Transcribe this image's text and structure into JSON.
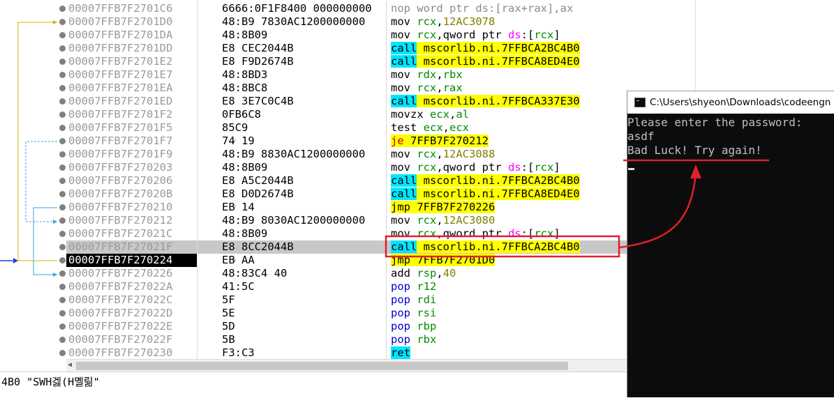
{
  "disassembly": {
    "rows": [
      {
        "address": "00007FFB7F2701C6",
        "bytes": "6666:0F1F8400 000000000",
        "mnemonic": "nop",
        "mclass": "nop",
        "operands": [
          {
            "t": "word ptr ds:[rax+rax],ax",
            "c": "nop"
          }
        ]
      },
      {
        "address": "00007FFB7F2701D0",
        "bytes": "48:B9 7830AC1200000000",
        "mnemonic": "mov",
        "mclass": "mov",
        "operands": [
          {
            "t": " ",
            "c": "plain"
          },
          {
            "t": "rcx",
            "c": "reg"
          },
          {
            "t": ",",
            "c": "plain"
          },
          {
            "t": "12AC3078",
            "c": "num"
          }
        ]
      },
      {
        "address": "00007FFB7F2701DA",
        "bytes": "48:8B09",
        "mnemonic": "mov",
        "mclass": "mov",
        "operands": [
          {
            "t": " ",
            "c": "plain"
          },
          {
            "t": "rcx",
            "c": "reg"
          },
          {
            "t": ",qword ptr ",
            "c": "plain"
          },
          {
            "t": "ds",
            "c": "seg"
          },
          {
            "t": ":[",
            "c": "plain"
          },
          {
            "t": "rcx",
            "c": "reg"
          },
          {
            "t": "]",
            "c": "plain"
          }
        ]
      },
      {
        "address": "00007FFB7F2701DD",
        "bytes": "E8 CEC2044B",
        "mnemonic": "call",
        "mclass": "call",
        "operands": [
          {
            "t": " mscorlib.ni.7FFBCA2BC4B0",
            "c": "tgtbg"
          }
        ]
      },
      {
        "address": "00007FFB7F2701E2",
        "bytes": "E8 F9D2674B",
        "mnemonic": "call",
        "mclass": "call",
        "operands": [
          {
            "t": " mscorlib.ni.7FFBCA8ED4E0",
            "c": "tgtbg"
          }
        ]
      },
      {
        "address": "00007FFB7F2701E7",
        "bytes": "48:8BD3",
        "mnemonic": "mov",
        "mclass": "mov",
        "operands": [
          {
            "t": " ",
            "c": "plain"
          },
          {
            "t": "rdx",
            "c": "reg"
          },
          {
            "t": ",",
            "c": "plain"
          },
          {
            "t": "rbx",
            "c": "reg"
          }
        ]
      },
      {
        "address": "00007FFB7F2701EA",
        "bytes": "48:8BC8",
        "mnemonic": "mov",
        "mclass": "mov",
        "operands": [
          {
            "t": " ",
            "c": "plain"
          },
          {
            "t": "rcx",
            "c": "reg"
          },
          {
            "t": ",",
            "c": "plain"
          },
          {
            "t": "rax",
            "c": "reg"
          }
        ]
      },
      {
        "address": "00007FFB7F2701ED",
        "bytes": "E8 3E7C0C4B",
        "mnemonic": "call",
        "mclass": "call",
        "operands": [
          {
            "t": " mscorlib.ni.7FFBCA337E30",
            "c": "tgtbg"
          }
        ]
      },
      {
        "address": "00007FFB7F2701F2",
        "bytes": "0FB6C8",
        "mnemonic": "movzx",
        "mclass": "mov",
        "operands": [
          {
            "t": " ",
            "c": "plain"
          },
          {
            "t": "ecx",
            "c": "reg"
          },
          {
            "t": ",",
            "c": "plain"
          },
          {
            "t": "al",
            "c": "reg"
          }
        ]
      },
      {
        "address": "00007FFB7F2701F5",
        "bytes": "85C9",
        "mnemonic": "test",
        "mclass": "mov",
        "operands": [
          {
            "t": " ",
            "c": "plain"
          },
          {
            "t": "ecx",
            "c": "reg"
          },
          {
            "t": ",",
            "c": "plain"
          },
          {
            "t": "ecx",
            "c": "reg"
          }
        ]
      },
      {
        "address": "00007FFB7F2701F7",
        "bytes": "74 19",
        "mnemonic": "je",
        "mclass": "jcc",
        "jump": "down",
        "operands": [
          {
            "t": " 7FFB7F270212",
            "c": "tgtbg"
          }
        ]
      },
      {
        "address": "00007FFB7F2701F9",
        "bytes": "48:B9 8830AC1200000000",
        "mnemonic": "mov",
        "mclass": "mov",
        "operands": [
          {
            "t": " ",
            "c": "plain"
          },
          {
            "t": "rcx",
            "c": "reg"
          },
          {
            "t": ",",
            "c": "plain"
          },
          {
            "t": "12AC3088",
            "c": "num"
          }
        ]
      },
      {
        "address": "00007FFB7F270203",
        "bytes": "48:8B09",
        "mnemonic": "mov",
        "mclass": "mov",
        "operands": [
          {
            "t": " ",
            "c": "plain"
          },
          {
            "t": "rcx",
            "c": "reg"
          },
          {
            "t": ",qword ptr ",
            "c": "plain"
          },
          {
            "t": "ds",
            "c": "seg"
          },
          {
            "t": ":[",
            "c": "plain"
          },
          {
            "t": "rcx",
            "c": "reg"
          },
          {
            "t": "]",
            "c": "plain"
          }
        ]
      },
      {
        "address": "00007FFB7F270206",
        "bytes": "E8 A5C2044B",
        "mnemonic": "call",
        "mclass": "call",
        "operands": [
          {
            "t": " mscorlib.ni.7FFBCA2BC4B0",
            "c": "tgtbg"
          }
        ]
      },
      {
        "address": "00007FFB7F27020B",
        "bytes": "E8 D0D2674B",
        "mnemonic": "call",
        "mclass": "call",
        "operands": [
          {
            "t": " mscorlib.ni.7FFBCA8ED4E0",
            "c": "tgtbg"
          }
        ]
      },
      {
        "address": "00007FFB7F270210",
        "bytes": "EB 14",
        "mnemonic": "jmp",
        "mclass": "jmp",
        "jump": "down",
        "operands": [
          {
            "t": " 7FFB7F270226",
            "c": "tgtbg"
          }
        ]
      },
      {
        "address": "00007FFB7F270212",
        "bytes": "48:B9 8030AC1200000000",
        "mnemonic": "mov",
        "mclass": "mov",
        "operands": [
          {
            "t": " ",
            "c": "plain"
          },
          {
            "t": "rcx",
            "c": "reg"
          },
          {
            "t": ",",
            "c": "plain"
          },
          {
            "t": "12AC3080",
            "c": "num"
          }
        ]
      },
      {
        "address": "00007FFB7F27021C",
        "bytes": "48:8B09",
        "mnemonic": "mov",
        "mclass": "mov",
        "operands": [
          {
            "t": " ",
            "c": "plain"
          },
          {
            "t": "rcx",
            "c": "reg"
          },
          {
            "t": ",qword ptr ",
            "c": "plain"
          },
          {
            "t": "ds",
            "c": "seg"
          },
          {
            "t": ":[",
            "c": "plain"
          },
          {
            "t": "rcx",
            "c": "reg"
          },
          {
            "t": "]",
            "c": "plain"
          }
        ]
      },
      {
        "address": "00007FFB7F27021F",
        "bytes": "E8 8CC2044B",
        "mnemonic": "call",
        "mclass": "call",
        "selected": true,
        "operands": [
          {
            "t": " mscorlib.ni.7FFBCA2BC4B0",
            "c": "tgtbg"
          }
        ]
      },
      {
        "address": "00007FFB7F270224",
        "bytes": "EB AA",
        "mnemonic": "jmp",
        "mclass": "jmp",
        "jump": "up",
        "cip": true,
        "operands": [
          {
            "t": " 7FFB7F2701D0",
            "c": "tgtbg"
          }
        ]
      },
      {
        "address": "00007FFB7F270226",
        "bytes": "48:83C4 40",
        "mnemonic": "add",
        "mclass": "mov",
        "operands": [
          {
            "t": " ",
            "c": "plain"
          },
          {
            "t": "rsp",
            "c": "reg"
          },
          {
            "t": ",",
            "c": "plain"
          },
          {
            "t": "40",
            "c": "num"
          }
        ]
      },
      {
        "address": "00007FFB7F27022A",
        "bytes": "41:5C",
        "mnemonic": "pop",
        "mclass": "pop",
        "operands": [
          {
            "t": " ",
            "c": "plain"
          },
          {
            "t": "r12",
            "c": "reg"
          }
        ]
      },
      {
        "address": "00007FFB7F27022C",
        "bytes": "5F",
        "mnemonic": "pop",
        "mclass": "pop",
        "operands": [
          {
            "t": " ",
            "c": "plain"
          },
          {
            "t": "rdi",
            "c": "reg"
          }
        ]
      },
      {
        "address": "00007FFB7F27022D",
        "bytes": "5E",
        "mnemonic": "pop",
        "mclass": "pop",
        "operands": [
          {
            "t": " ",
            "c": "plain"
          },
          {
            "t": "rsi",
            "c": "reg"
          }
        ]
      },
      {
        "address": "00007FFB7F27022E",
        "bytes": "5D",
        "mnemonic": "pop",
        "mclass": "pop",
        "operands": [
          {
            "t": " ",
            "c": "plain"
          },
          {
            "t": "rbp",
            "c": "reg"
          }
        ]
      },
      {
        "address": "00007FFB7F27022F",
        "bytes": "5B",
        "mnemonic": "pop",
        "mclass": "pop",
        "operands": [
          {
            "t": " ",
            "c": "plain"
          },
          {
            "t": "rbx",
            "c": "reg"
          }
        ]
      },
      {
        "address": "00007FFB7F270230",
        "bytes": "F3:C3",
        "mnemonic": "ret",
        "mclass": "ret",
        "operands": []
      }
    ]
  },
  "status_bar": {
    "text": "4B0 \"SWH겛(H몔릶\""
  },
  "console": {
    "title": "C:\\Users\\shyeon\\Downloads\\codeengn",
    "lines": [
      "Please enter the password:",
      "asdf",
      "Bad Luck! Try again!"
    ]
  },
  "colors": {
    "annotation_red": "#e0202a",
    "call_highlight": "#00e5ff",
    "jump_highlight": "#ffff00"
  }
}
